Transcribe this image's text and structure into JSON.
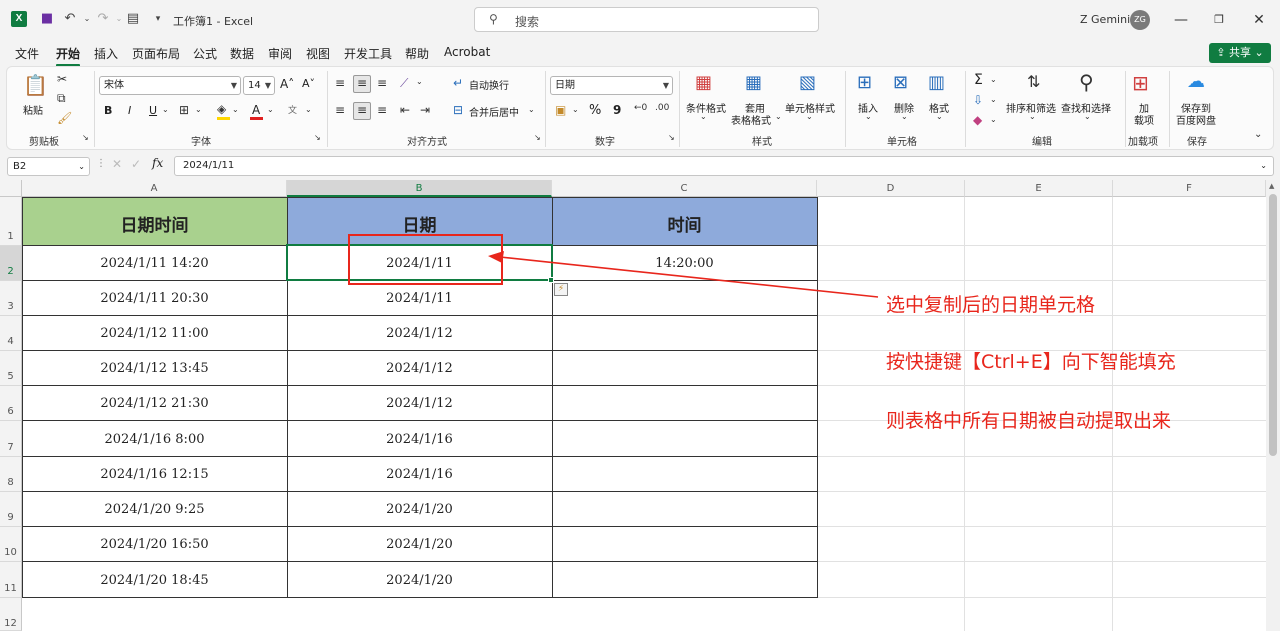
{
  "titlebar": {
    "app_icon": "X",
    "title": "工作簿1 - Excel",
    "search_placeholder": "搜索",
    "user_name": "Z Gemini",
    "user_initials": "ZG",
    "min_glyph": "—",
    "max_glyph": "❐",
    "close_glyph": "✕"
  },
  "menu": {
    "tabs": [
      "文件",
      "开始",
      "插入",
      "页面布局",
      "公式",
      "数据",
      "审阅",
      "视图",
      "开发工具",
      "帮助",
      "Acrobat"
    ],
    "active": "开始",
    "share_label": "共享"
  },
  "ribbon": {
    "clipboard": {
      "paste": "粘贴",
      "group": "剪贴板"
    },
    "font": {
      "font_name": "宋体",
      "font_size": "14",
      "bold": "B",
      "italic": "I",
      "underline": "U",
      "grow": "A˄",
      "shrink": "A˅",
      "group": "字体"
    },
    "alignment": {
      "wrap": "自动换行",
      "merge": "合并后居中",
      "group": "对齐方式"
    },
    "number": {
      "format": "日期",
      "percent": "%",
      "comma": "9",
      "group": "数字"
    },
    "styles": {
      "conditional": "条件格式",
      "table_1": "套用",
      "table_2": "表格格式",
      "cell_styles": "单元格样式",
      "group": "样式"
    },
    "cells": {
      "insert": "插入",
      "delete": "删除",
      "format": "格式",
      "group": "单元格"
    },
    "editing": {
      "sigma": "Σ",
      "sort": "排序和筛选",
      "find": "查找和选择",
      "group": "编辑"
    },
    "addins": {
      "label_1": "加",
      "label_2": "载项",
      "group": "加载项"
    },
    "save": {
      "label_1": "保存到",
      "label_2": "百度网盘",
      "group": "保存"
    }
  },
  "formula_bar": {
    "name_box": "B2",
    "fx": "fx",
    "content": "2024/1/11"
  },
  "sheet": {
    "columns": [
      "A",
      "B",
      "C",
      "D",
      "E",
      "F"
    ],
    "selected_column": "B",
    "rows": [
      "1",
      "2",
      "3",
      "4",
      "5",
      "6",
      "7",
      "8",
      "9",
      "10",
      "11",
      "12"
    ],
    "headers": [
      "日期时间",
      "日期",
      "时间"
    ],
    "header_colors": {
      "A": "#a9d18e",
      "B": "#8eaadb",
      "C": "#8eaadb"
    },
    "data": [
      [
        "2024/1/11  14:20",
        "2024/1/11",
        "14:20:00"
      ],
      [
        "2024/1/11  20:30",
        "2024/1/11",
        ""
      ],
      [
        "2024/1/12  11:00",
        "2024/1/12",
        ""
      ],
      [
        "2024/1/12  13:45",
        "2024/1/12",
        ""
      ],
      [
        "2024/1/12  21:30",
        "2024/1/12",
        ""
      ],
      [
        "2024/1/16  8:00",
        "2024/1/16",
        ""
      ],
      [
        "2024/1/16  12:15",
        "2024/1/16",
        ""
      ],
      [
        "2024/1/20  9:25",
        "2024/1/20",
        ""
      ],
      [
        "2024/1/20  16:50",
        "2024/1/20",
        ""
      ],
      [
        "2024/1/20  18:45",
        "2024/1/20",
        ""
      ]
    ]
  },
  "annotations": {
    "lines": [
      "选中复制后的日期单元格",
      "按快捷键【Ctrl+E】向下智能填充",
      "则表格中所有日期被自动提取出来"
    ],
    "color": "#e8261c"
  }
}
